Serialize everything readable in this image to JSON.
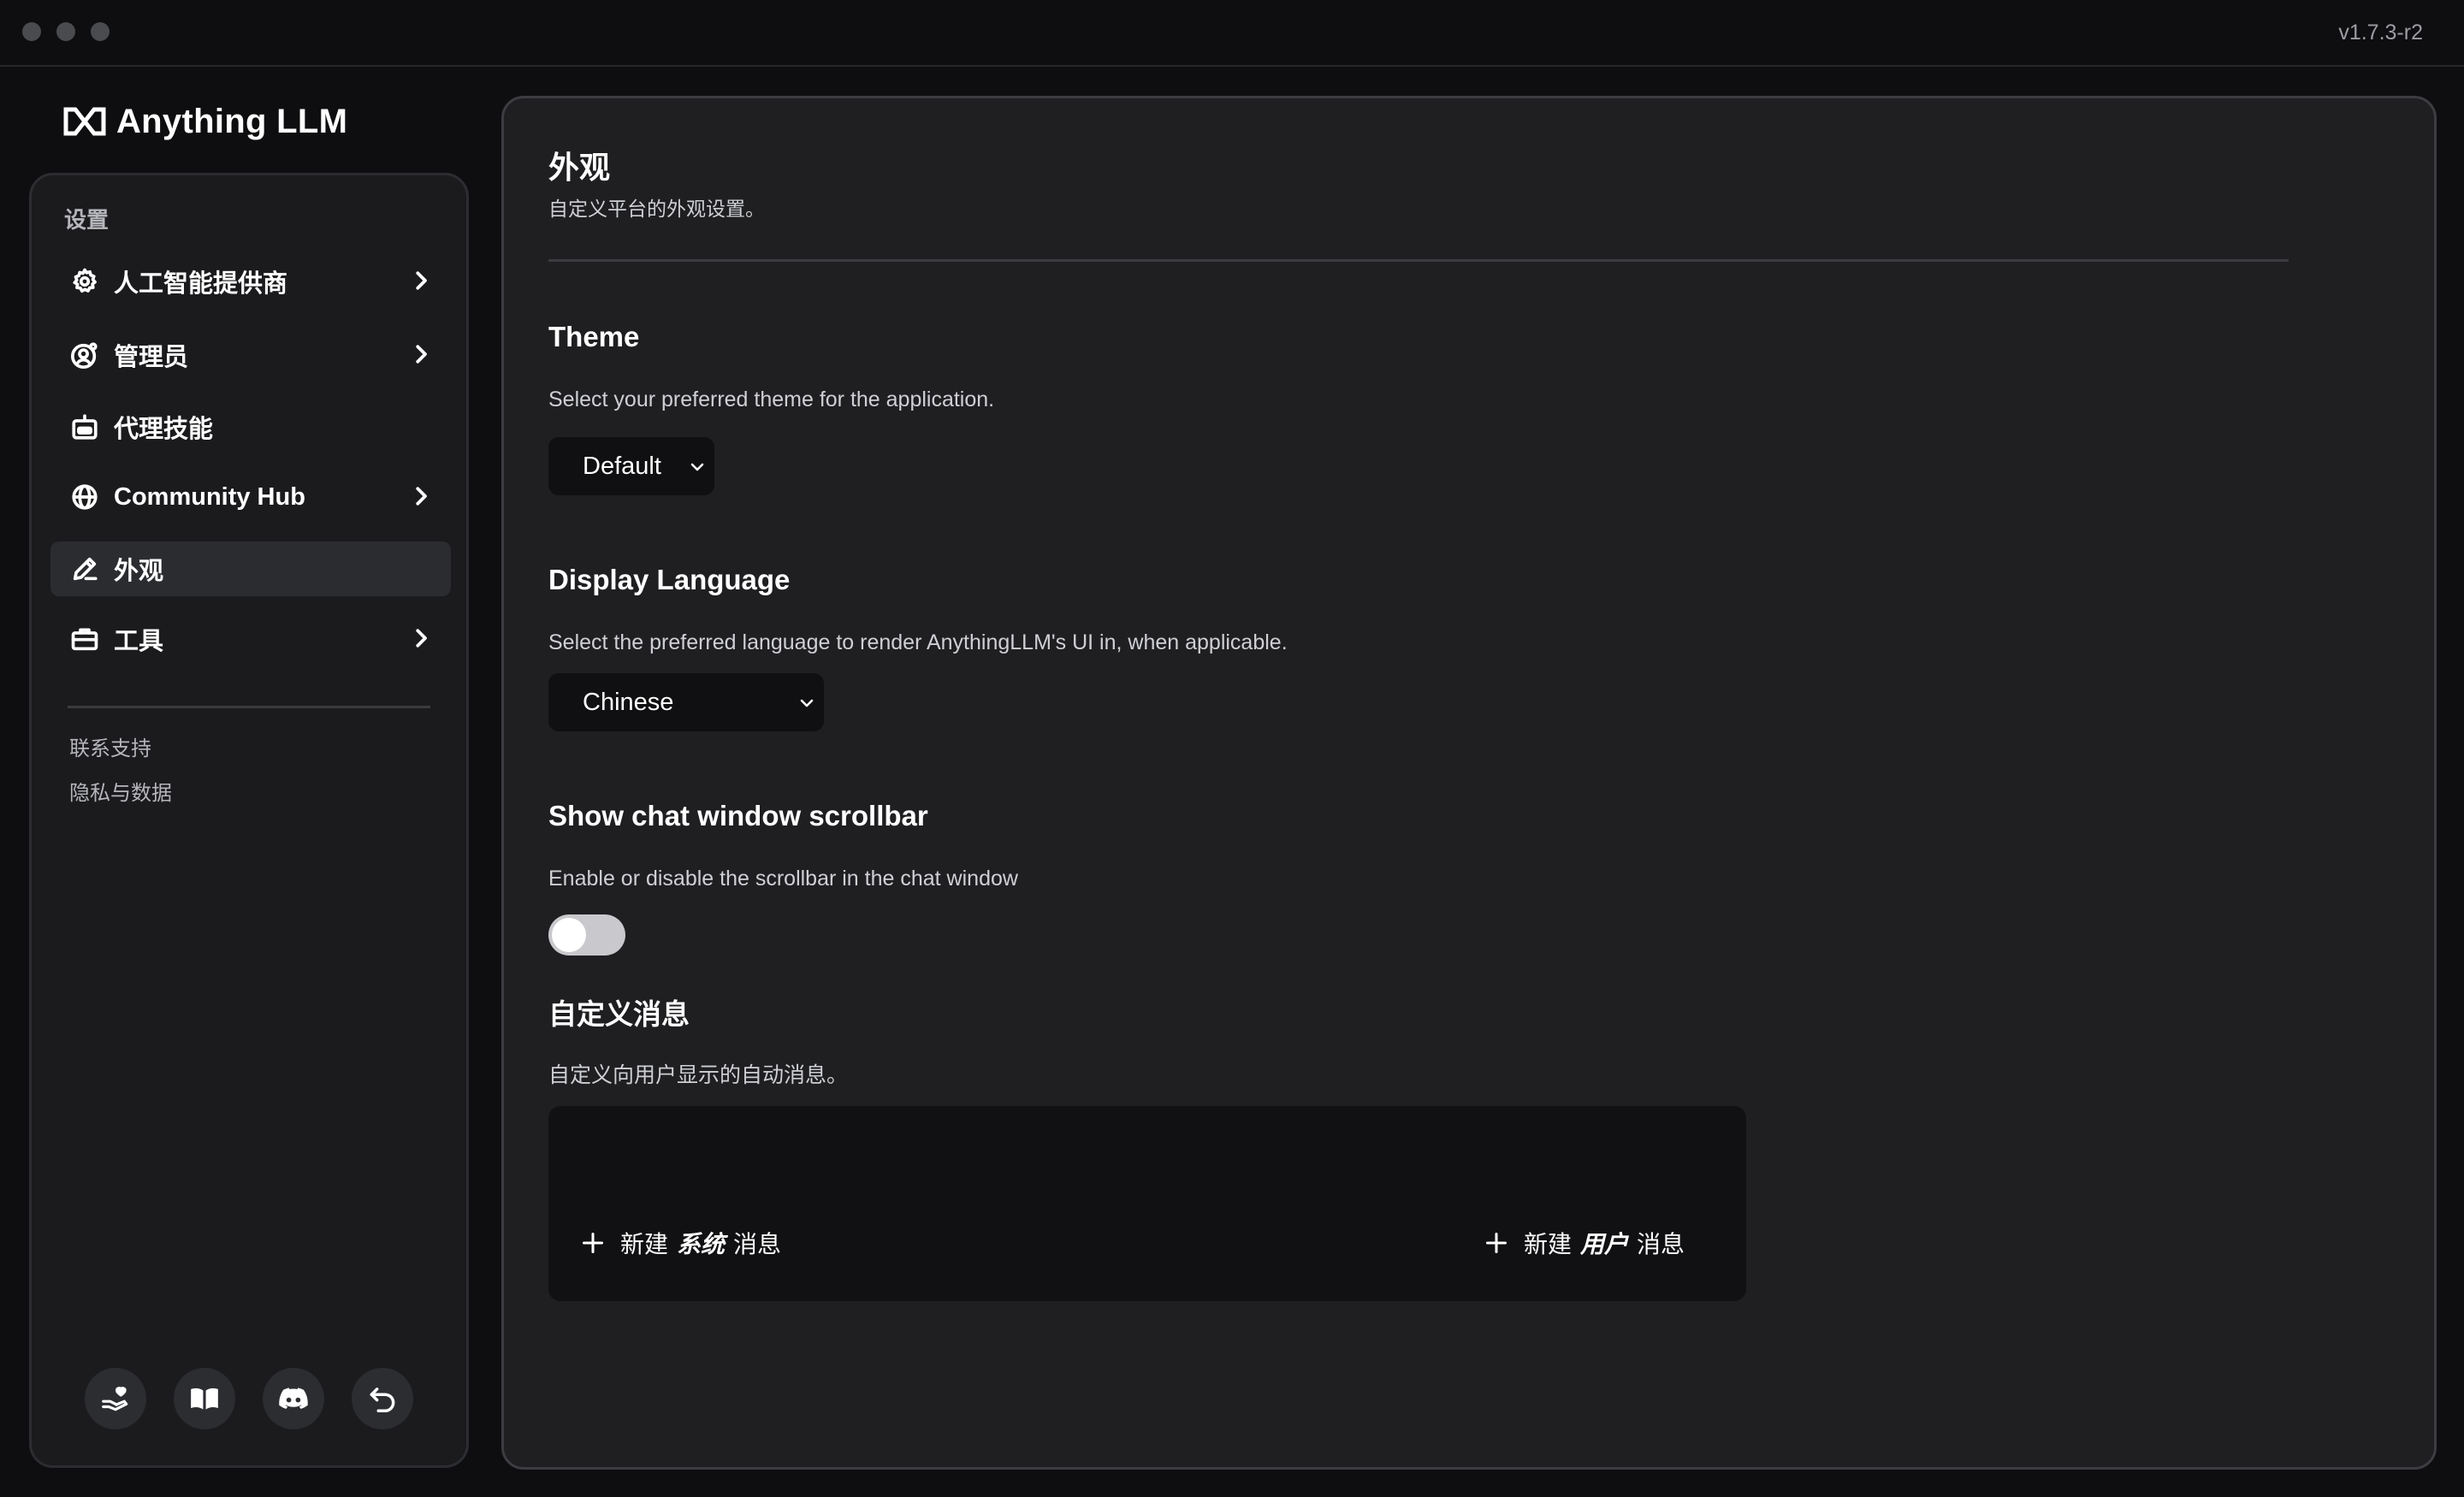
{
  "window": {
    "version": "v1.7.3-r2"
  },
  "brand": {
    "name": "Anything LLM"
  },
  "sidebar": {
    "heading": "设置",
    "items": [
      {
        "label": "人工智能提供商",
        "icon": "gear-icon",
        "has_chevron": true
      },
      {
        "label": "管理员",
        "icon": "user-circle-gear-icon",
        "has_chevron": true
      },
      {
        "label": "代理技能",
        "icon": "robot-icon",
        "has_chevron": false
      },
      {
        "label": "Community Hub",
        "icon": "globe-icon",
        "has_chevron": true
      },
      {
        "label": "外观",
        "icon": "pencil-icon",
        "has_chevron": false,
        "active": true
      },
      {
        "label": "工具",
        "icon": "briefcase-icon",
        "has_chevron": true
      }
    ],
    "footer_links": [
      "联系支持",
      "隐私与数据"
    ],
    "bottom_buttons": [
      "hand-heart-icon",
      "book-icon",
      "discord-icon",
      "back-arrow-icon"
    ]
  },
  "main": {
    "title": "外观",
    "subtitle": "自定义平台的外观设置。",
    "theme": {
      "title": "Theme",
      "description": "Select your preferred theme for the application.",
      "selected": "Default"
    },
    "language": {
      "title": "Display Language",
      "description": "Select the preferred language to render AnythingLLM's UI in, when applicable.",
      "selected": "Chinese"
    },
    "scrollbar": {
      "title": "Show chat window scrollbar",
      "description": "Enable or disable the scrollbar in the chat window",
      "enabled": false
    },
    "custom_messages": {
      "title": "自定义消息",
      "description": "自定义向用户显示的自动消息。",
      "new_system": {
        "prefix": "新建",
        "emphasis": "系统",
        "suffix": "消息"
      },
      "new_user": {
        "prefix": "新建",
        "emphasis": "用户",
        "suffix": "消息"
      }
    }
  },
  "colors": {
    "background": "#0e0e10",
    "panel": "#1f1f22",
    "sidebar": "#1b1b1e",
    "active_item": "#2b2c30",
    "text": "#ffffff",
    "muted_text": "#cfd0d4"
  }
}
